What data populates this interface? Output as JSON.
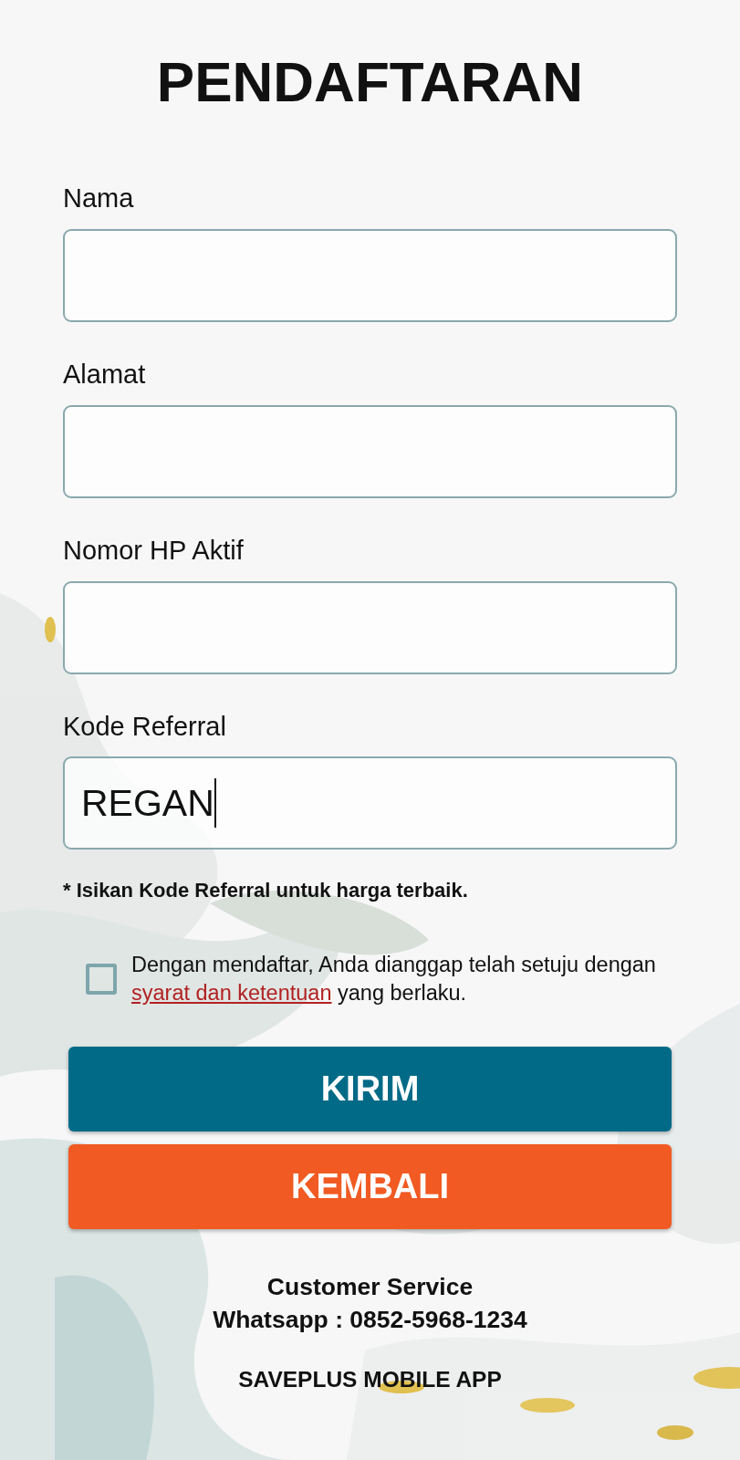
{
  "title": "PENDAFTARAN",
  "fields": [
    {
      "label": "Nama"
    },
    {
      "label": "Alamat"
    },
    {
      "label": "Nomor HP Aktif"
    },
    {
      "label": "Kode Referral",
      "value": "REGAN",
      "focused": true
    }
  ],
  "note": "* Isikan Kode Referral untuk harga terbaik.",
  "consent": {
    "checked": false,
    "text_before": "Dengan mendaftar, Anda dianggap telah setuju dengan",
    "link": "syarat dan ketentuan",
    "text_after": "yang berlaku."
  },
  "buttons": [
    {
      "label": "KIRIM",
      "kind": "primary"
    },
    {
      "label": "KEMBALI",
      "kind": "secondary"
    }
  ],
  "footer": {
    "contact_title": "Customer Service",
    "contact_line": "Whatsapp : 0852-5968-1234",
    "app_name": "SAVEPLUS MOBILE APP"
  }
}
